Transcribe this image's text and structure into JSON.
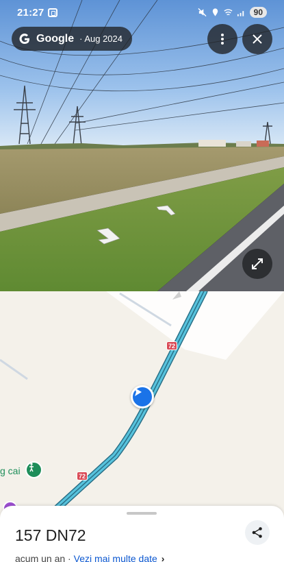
{
  "status_bar": {
    "time": "21:27",
    "battery": "90"
  },
  "street_view": {
    "brand": "Google",
    "date": "· Aug 2024",
    "buttons": {
      "more": "more-vert-icon",
      "close": "close-icon",
      "expand": "expand-icon"
    }
  },
  "map": {
    "road_shields": [
      "72",
      "72"
    ],
    "poi_label": "g cai",
    "road_color": "#2ba8c9"
  },
  "place_sheet": {
    "address": "157 DN72",
    "age": "acum un an",
    "separator": " · ",
    "more_data_link": "Vezi mai multe date"
  },
  "colors": {
    "accent": "#1a73e8",
    "link": "#0b57d0",
    "poi_green": "#1e8e5a"
  }
}
